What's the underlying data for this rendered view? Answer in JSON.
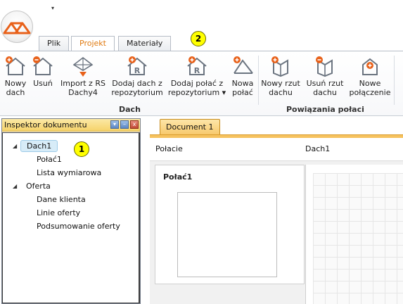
{
  "qat": {
    "dropdown_glyph": "▾"
  },
  "tabs": [
    {
      "label": "Plik"
    },
    {
      "label": "Projekt"
    },
    {
      "label": "Materiały"
    }
  ],
  "callouts": {
    "one": "1",
    "two": "2"
  },
  "ribbon": {
    "buttons": [
      {
        "label": "Nowy\ndach",
        "icon": "house-add-icon"
      },
      {
        "label": "Usuń",
        "icon": "house-remove-icon"
      },
      {
        "label": "Import z RS\nDachy4",
        "icon": "import-icon"
      },
      {
        "label": "Dodaj dach z\nrepozytorium",
        "icon": "repository-roof-icon"
      },
      {
        "label": "Dodaj połać z\nrepozytorium ▾",
        "icon": "repository-slope-icon"
      },
      {
        "label": "Nowa\npołać",
        "icon": "new-slope-icon"
      },
      {
        "label": "Nowy rzut\ndachu",
        "icon": "new-projection-icon"
      },
      {
        "label": "Usuń rzut\ndachu",
        "icon": "remove-projection-icon"
      },
      {
        "label": "Nowe\npołączenie",
        "icon": "new-connection-icon"
      }
    ],
    "groups": {
      "dach": "Dach",
      "powiazania": "Powiązania połaci"
    }
  },
  "inspector": {
    "title": "Inspektor dokumentu",
    "controls": {
      "dropdown": "▾",
      "minimize": "–",
      "close": "x"
    },
    "tree": {
      "dach1": "Dach1",
      "polac1": "Połać1",
      "lista": "Lista wymiarowa",
      "oferta": "Oferta",
      "dane_klienta": "Dane klienta",
      "linie_oferty": "Linie oferty",
      "podsumowanie": "Podsumowanie oferty"
    }
  },
  "document": {
    "tab": "Document 1",
    "header": {
      "left": "Połacie",
      "right": "Dach1"
    },
    "panel_title": "Połać1"
  },
  "colors": {
    "accent": "#e07a10",
    "inspector_title": "#f6d36a",
    "doc_tab": "#f7c86a",
    "selection": "#d7ecf8"
  }
}
